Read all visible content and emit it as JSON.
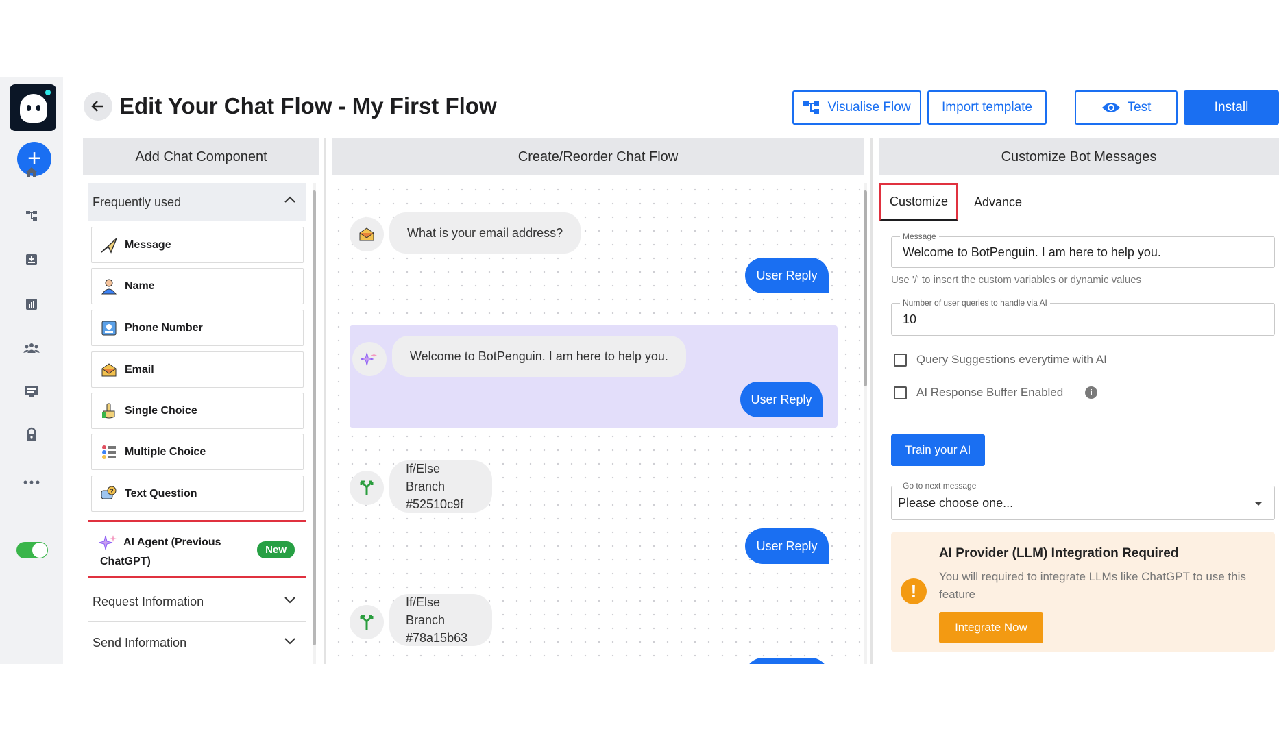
{
  "header": {
    "title": "Edit Your Chat Flow - My First Flow",
    "visualise_label": "Visualise Flow",
    "import_label": "Import template",
    "test_label": "Test",
    "install_label": "Install"
  },
  "panels": {
    "left_title": "Add Chat Component",
    "center_title": "Create/Reorder Chat Flow",
    "right_title": "Customize Bot Messages"
  },
  "components": {
    "section_label": "Frequently used",
    "items": [
      {
        "label": "Message",
        "icon": "paper-plane-icon"
      },
      {
        "label": "Name",
        "icon": "person-icon"
      },
      {
        "label": "Phone Number",
        "icon": "contact-card-icon"
      },
      {
        "label": "Email",
        "icon": "envelope-icon"
      },
      {
        "label": "Single Choice",
        "icon": "pointing-hand-icon"
      },
      {
        "label": "Multiple Choice",
        "icon": "option-list-icon"
      },
      {
        "label": "Text Question",
        "icon": "speech-question-icon"
      }
    ],
    "ai_agent": {
      "label": "AI Agent (Previous ChatGPT)",
      "badge": "New",
      "icon": "sparkles-icon"
    },
    "request_info_label": "Request Information",
    "send_info_label": "Send Information"
  },
  "flow": {
    "email_question": "What is your email address?",
    "ai_message": "Welcome to BotPenguin. I am here to help you.",
    "user_reply": "User Reply",
    "branch1_title": "If/Else Branch",
    "branch1_id": "#52510c9f",
    "branch2_title": "If/Else Branch",
    "branch2_id": "#78a15b63"
  },
  "settings": {
    "tab_customize": "Customize",
    "tab_advance": "Advance",
    "message_label": "Message",
    "message_value": "Welcome to BotPenguin. I am here to help you.",
    "helper_text": "Use '/' to insert the custom variables or dynamic values",
    "queries_label": "Number of user queries to handle via AI",
    "queries_value": "10",
    "query_suggestions_label": "Query Suggestions everytime with AI",
    "query_suggestions_checked": false,
    "buffer_label": "AI Response Buffer Enabled",
    "buffer_checked": false,
    "train_label": "Train your AI",
    "next_message_label": "Go to next message",
    "next_message_value": "Please choose one..."
  },
  "alert": {
    "title": "AI Provider (LLM) Integration Required",
    "text": "You will required to integrate LLMs like ChatGPT to use this feature",
    "button_label": "Integrate Now"
  },
  "colors": {
    "accent": "#1a6ff2",
    "highlight_border": "#e0313f",
    "new_badge": "#27a044",
    "warning": "#f39a12",
    "ai_block": "#e3defa"
  }
}
